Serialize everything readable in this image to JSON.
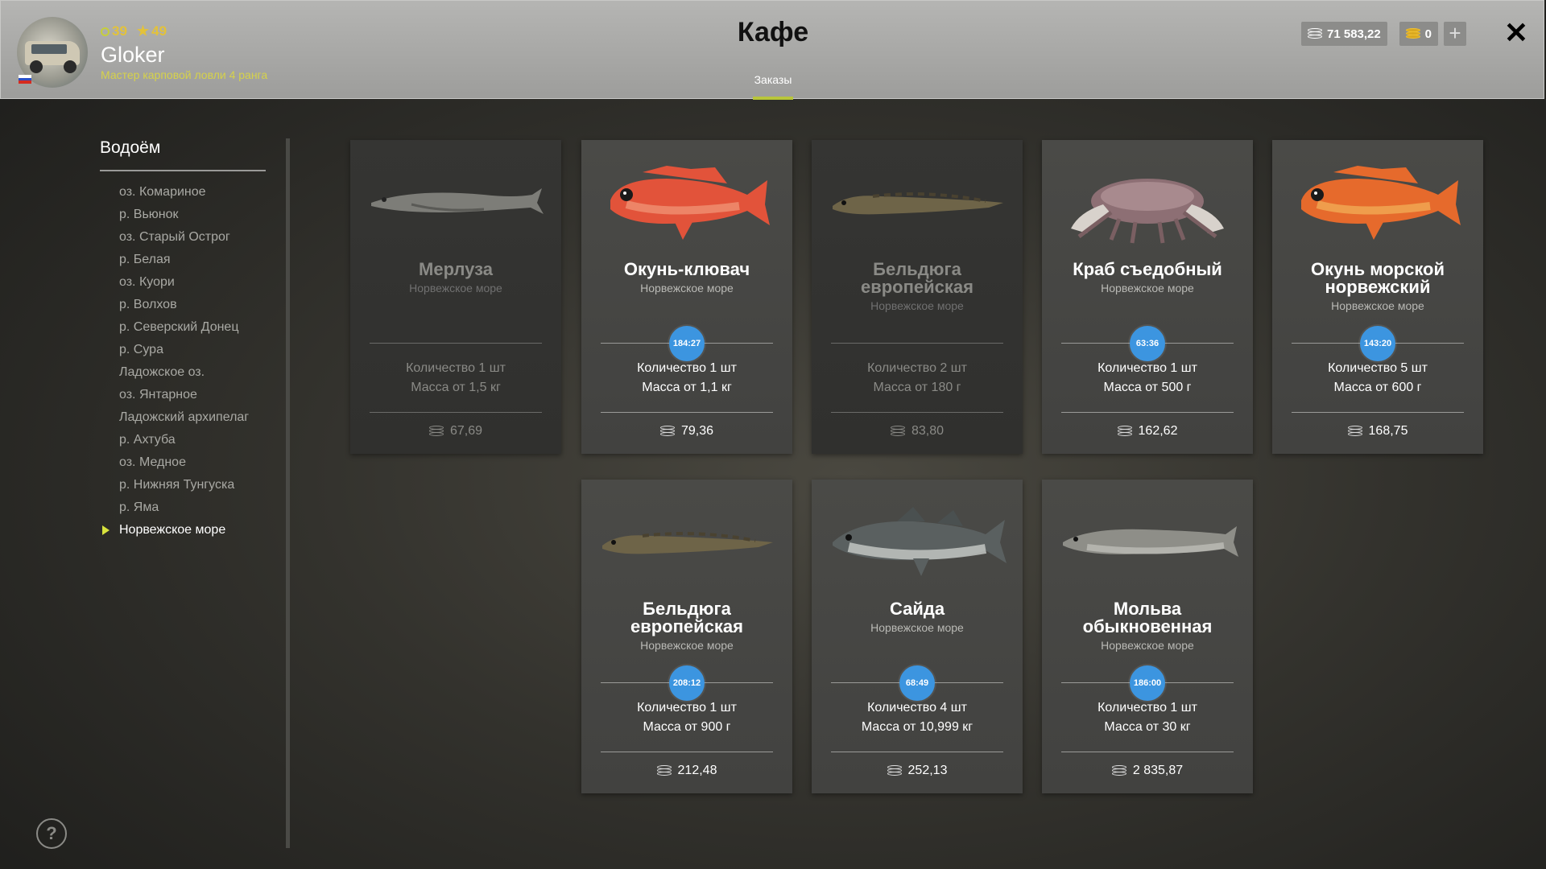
{
  "header": {
    "title": "Кафе",
    "tab": "Заказы",
    "player": {
      "level": "39",
      "stars": "49",
      "name": "Gloker",
      "rank": "Мастер карповой ловли 4 ранга"
    },
    "silver": "71 583,22",
    "gold": "0",
    "plus": "+",
    "close": "✕"
  },
  "sidebar": {
    "title": "Водоём",
    "locations": [
      "оз. Комариное",
      "р. Вьюнок",
      "оз. Старый Острог",
      "р. Белая",
      "оз. Куори",
      "р. Волхов",
      "р. Северский Донец",
      "р. Сура",
      "Ладожское оз.",
      "оз. Янтарное",
      "Ладожский архипелаг",
      "р. Ахтуба",
      "оз. Медное",
      "р. Нижняя Тунгуска",
      "р. Яма",
      "Норвежское море"
    ],
    "active_index": 15
  },
  "help": "?",
  "orders": [
    {
      "name": "Мерлуза",
      "region": "Норвежское море",
      "qty": "Количество 1 шт",
      "mass": "Масса от 1,5 кг",
      "price": "67,69",
      "timer": "",
      "active": false,
      "fish": "hake"
    },
    {
      "name": "Окунь-клювач",
      "region": "Норвежское море",
      "qty": "Количество 1 шт",
      "mass": "Масса от 1,1 кг",
      "price": "79,36",
      "timer": "184:27",
      "active": true,
      "fish": "redfish"
    },
    {
      "name": "Бельдюга европейская",
      "region": "Норвежское море",
      "qty": "Количество 2 шт",
      "mass": "Масса от 180 г",
      "price": "83,80",
      "timer": "",
      "active": false,
      "fish": "eelpout"
    },
    {
      "name": "Краб съедобный",
      "region": "Норвежское море",
      "qty": "Количество 1 шт",
      "mass": "Масса от 500 г",
      "price": "162,62",
      "timer": "63:36",
      "active": true,
      "fish": "crab"
    },
    {
      "name": "Окунь морской норвежский",
      "region": "Норвежское море",
      "qty": "Количество 5 шт",
      "mass": "Масса от 600 г",
      "price": "168,75",
      "timer": "143:20",
      "active": true,
      "fish": "redfish2"
    },
    {
      "name": "Бельдюга европейская",
      "region": "Норвежское море",
      "qty": "Количество 1 шт",
      "mass": "Масса от 900 г",
      "price": "212,48",
      "timer": "208:12",
      "active": true,
      "fish": "eelpout"
    },
    {
      "name": "Сайда",
      "region": "Норвежское море",
      "qty": "Количество 4 шт",
      "mass": "Масса от 10,999 кг",
      "price": "252,13",
      "timer": "68:49",
      "active": true,
      "fish": "saithe"
    },
    {
      "name": "Мольва обыкновенная",
      "region": "Норвежское море",
      "qty": "Количество 1 шт",
      "mass": "Масса от 30 кг",
      "price": "2 835,87",
      "timer": "186:00",
      "active": true,
      "fish": "ling"
    }
  ]
}
